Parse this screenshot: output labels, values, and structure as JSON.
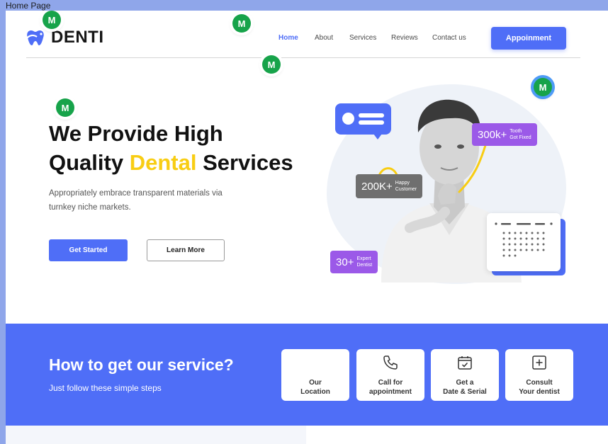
{
  "frame_label": "Home Page",
  "brand": {
    "name": "DENTI",
    "accent": "#4f6ef7",
    "highlight": "#f8cd13"
  },
  "nav": {
    "items": [
      {
        "label": "Home",
        "active": true
      },
      {
        "label": "About",
        "active": false
      },
      {
        "label": "Services",
        "active": false
      },
      {
        "label": "Reviews",
        "active": false
      },
      {
        "label": "Contact us",
        "active": false
      }
    ],
    "cta_label": "Appoinment"
  },
  "hero": {
    "title_line1": "We Provide High",
    "title_pre": "Quality ",
    "title_highlight": "Dental",
    "title_post": " Services",
    "description": "Appropriately embrace transparent materials via turnkey niche markets.",
    "primary_button": "Get Started",
    "secondary_button": "Learn More"
  },
  "stats": [
    {
      "value": "300k+",
      "label_line1": "Tooth",
      "label_line2": "Got Fixed"
    },
    {
      "value": "200K+",
      "label_line1": "Happy",
      "label_line2": "Customer"
    },
    {
      "value": "30+",
      "label_line1": "Expert",
      "label_line2": "Dentist"
    }
  ],
  "markers": [
    "M",
    "M",
    "M",
    "M",
    "M"
  ],
  "service": {
    "title": "How to get our service?",
    "subtitle": "Just follow these simple steps",
    "steps": [
      {
        "line1": "Our",
        "line2": "Location",
        "icon": "location-icon"
      },
      {
        "line1": "Call for",
        "line2": "appointment",
        "icon": "phone-icon"
      },
      {
        "line1": "Get a",
        "line2": "Date & Serial",
        "icon": "calendar-check-icon"
      },
      {
        "line1": "Consult",
        "line2": "Your dentist",
        "icon": "plus-square-icon"
      }
    ]
  }
}
